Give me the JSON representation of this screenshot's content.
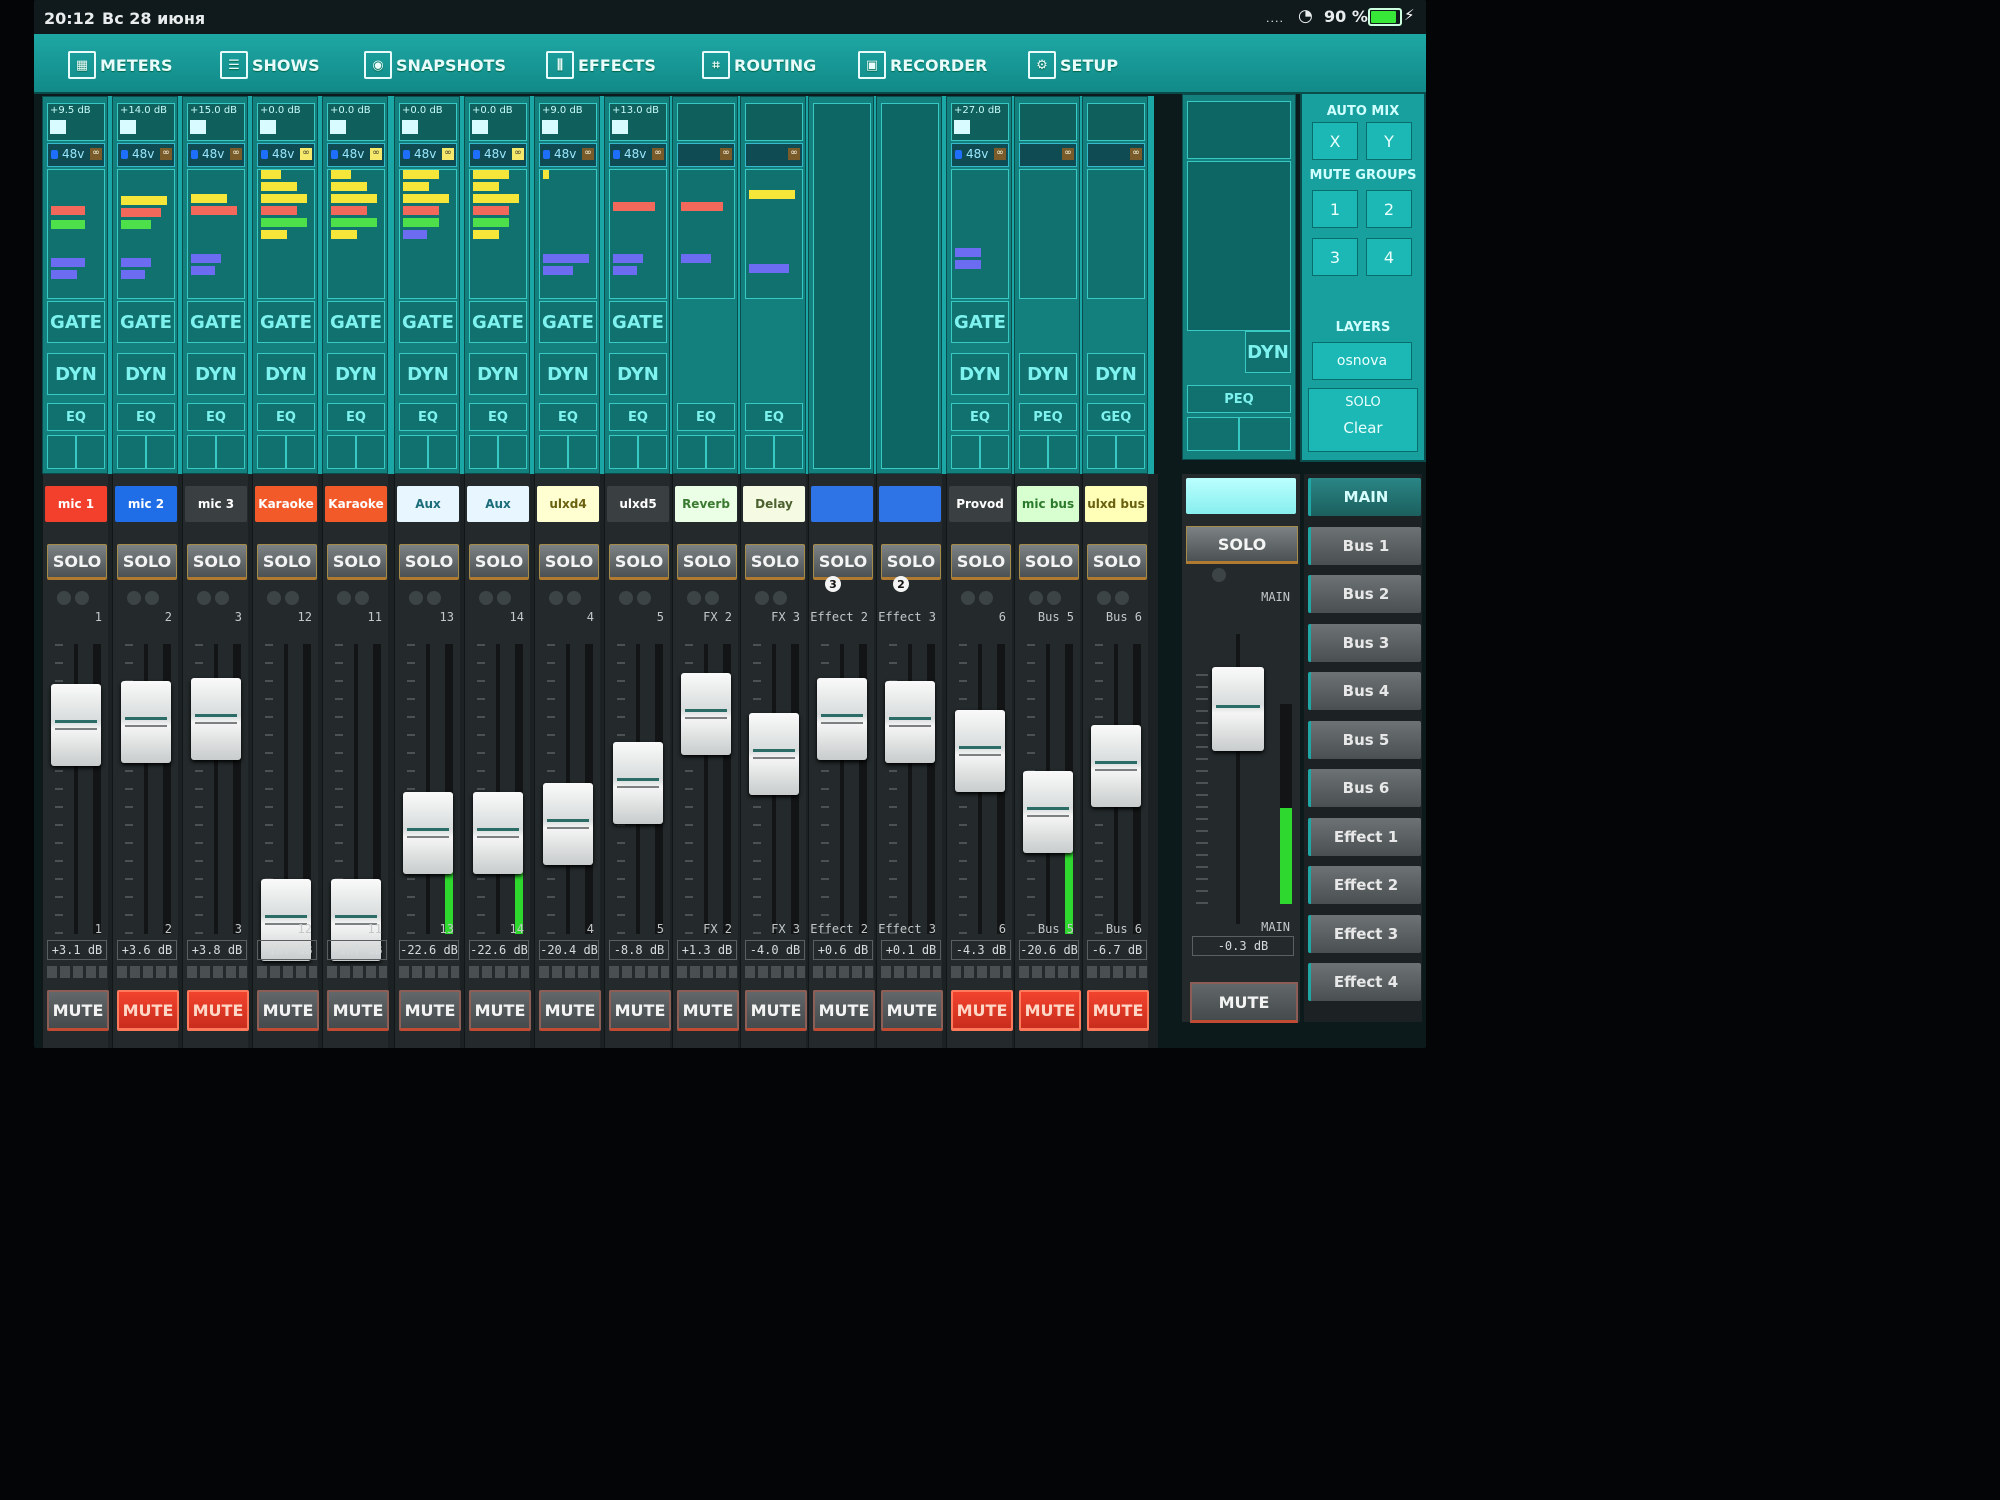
{
  "status": {
    "time": "20:12",
    "date": "Вс 28 июня",
    "signal": "....",
    "battery": "90 %",
    "battery_level": 0.9
  },
  "nav": [
    {
      "label": "METERS",
      "icon": "meters-icon"
    },
    {
      "label": "SHOWS",
      "icon": "list-icon"
    },
    {
      "label": "SNAPSHOTS",
      "icon": "camera-icon"
    },
    {
      "label": "EFFECTS",
      "icon": "sliders-icon"
    },
    {
      "label": "ROUTING",
      "icon": "routing-icon"
    },
    {
      "label": "RECORDER",
      "icon": "recorder-icon"
    },
    {
      "label": "SETUP",
      "icon": "gear-icon"
    }
  ],
  "upper": {
    "gate": "GATE",
    "dyn": "DYN",
    "eq": "EQ",
    "peq": "PEQ",
    "geq": "GEQ",
    "ph": "48v",
    "main_dyn": "DYN",
    "main_peq": "PEQ"
  },
  "right_panel": {
    "auto_mix": "AUTO MIX",
    "x": "X",
    "y": "Y",
    "mute_groups": "MUTE GROUPS",
    "groups": [
      "1",
      "2",
      "3",
      "4"
    ],
    "layers": "LAYERS",
    "layer_name": "osnova",
    "solo": "SOLO",
    "clear": "Clear"
  },
  "channels": [
    {
      "name": "mic 1",
      "color": "#f2402d",
      "text": "#fff",
      "trim": "+9.5 dB",
      "num": "1",
      "bot": "1",
      "db": "+3.1 dB",
      "mute": false,
      "level": 0.72,
      "ph": true
    },
    {
      "name": "mic 2",
      "color": "#1f6ee8",
      "text": "#fff",
      "trim": "+14.0 dB",
      "num": "2",
      "bot": "2",
      "db": "+3.6 dB",
      "mute": true,
      "level": 0.73,
      "ph": true
    },
    {
      "name": "mic 3",
      "color": "#3a3f41",
      "text": "#fff",
      "trim": "+15.0 dB",
      "num": "3",
      "bot": "3",
      "db": "+3.8 dB",
      "mute": true,
      "level": 0.74,
      "ph": true
    },
    {
      "name": "Karaoke",
      "color": "#f25a2a",
      "text": "#fff",
      "trim": "+0.0 dB",
      "num": "12",
      "bot": "12",
      "db": "-inf dB",
      "mute": false,
      "level": 0.05,
      "ph": true
    },
    {
      "name": "Karaoke",
      "color": "#f25a2a",
      "text": "#fff",
      "trim": "+0.0 dB",
      "num": "11",
      "bot": "11",
      "db": "-inf dB",
      "mute": false,
      "level": 0.05,
      "ph": true
    },
    {
      "name": "Aux",
      "color": "#e8f7ff",
      "text": "#1b6d7a",
      "trim": "+0.0 dB",
      "num": "13",
      "bot": "13",
      "db": "-22.6 dB",
      "mute": false,
      "level": 0.35,
      "ph": true
    },
    {
      "name": "Aux",
      "color": "#e8f7ff",
      "text": "#1b6d7a",
      "trim": "+0.0 dB",
      "num": "14",
      "bot": "14",
      "db": "-22.6 dB",
      "mute": false,
      "level": 0.35,
      "ph": true
    },
    {
      "name": "ulxd4",
      "color": "#ffffd2",
      "text": "#6a6010",
      "trim": "+9.0 dB",
      "num": "4",
      "bot": "4",
      "db": "-20.4 dB",
      "mute": false,
      "level": 0.38,
      "ph": true
    },
    {
      "name": "ulxd5",
      "color": "#3a3f41",
      "text": "#fff",
      "trim": "+13.0 dB",
      "num": "5",
      "bot": "5",
      "db": "-8.8 dB",
      "mute": false,
      "level": 0.52,
      "ph": true
    },
    {
      "name": "Reverb",
      "color": "#eaffe6",
      "text": "#3a7a30",
      "trim": "",
      "num": "FX 2",
      "bot": "FX 2",
      "db": "+1.3 dB",
      "mute": false,
      "level": 0.76,
      "ph": false
    },
    {
      "name": "Delay",
      "color": "#f4fbe2",
      "text": "#4c6030",
      "trim": "",
      "num": "FX 3",
      "bot": "FX 3",
      "db": "-4.0 dB",
      "mute": false,
      "level": 0.62,
      "ph": false
    },
    {
      "name": "",
      "color": "#2f74e6",
      "text": "#fff",
      "trim": "",
      "num": "Effect 2",
      "bot": "Effect 2",
      "db": "+0.6 dB",
      "mute": false,
      "level": 0.74,
      "ph": false,
      "badge": "3"
    },
    {
      "name": "",
      "color": "#2f74e6",
      "text": "#fff",
      "trim": "",
      "num": "Effect 3",
      "bot": "Effect 3",
      "db": "+0.1 dB",
      "mute": false,
      "level": 0.73,
      "ph": false,
      "badge": "2"
    },
    {
      "name": "Provod",
      "color": "#3a3f41",
      "text": "#fff",
      "trim": "+27.0 dB",
      "num": "6",
      "bot": "6",
      "db": "-4.3 dB",
      "mute": true,
      "level": 0.63,
      "ph": true
    },
    {
      "name": "mic bus",
      "color": "#d8ffcf",
      "text": "#2c7a2c",
      "trim": "",
      "num": "Bus 5",
      "bot": "Bus 5",
      "db": "-20.6 dB",
      "mute": true,
      "level": 0.42,
      "ph": false
    },
    {
      "name": "ulxd bus",
      "color": "#ffffb8",
      "text": "#6a6010",
      "trim": "",
      "num": "Bus 6",
      "bot": "Bus 6",
      "db": "-6.7 dB",
      "mute": true,
      "level": 0.58,
      "ph": false
    }
  ],
  "main_strip": {
    "solo": "SOLO",
    "top_label": "MAIN",
    "bot_label": "MAIN",
    "db": "-0.3 dB",
    "mute": "MUTE",
    "level": 0.74
  },
  "buses": [
    "MAIN",
    "Bus 1",
    "Bus 2",
    "Bus 3",
    "Bus 4",
    "Bus 5",
    "Bus 6",
    "Effect 1",
    "Effect 2",
    "Effect 3",
    "Effect 4"
  ],
  "labels": {
    "solo": "SOLO",
    "mute": "MUTE"
  }
}
